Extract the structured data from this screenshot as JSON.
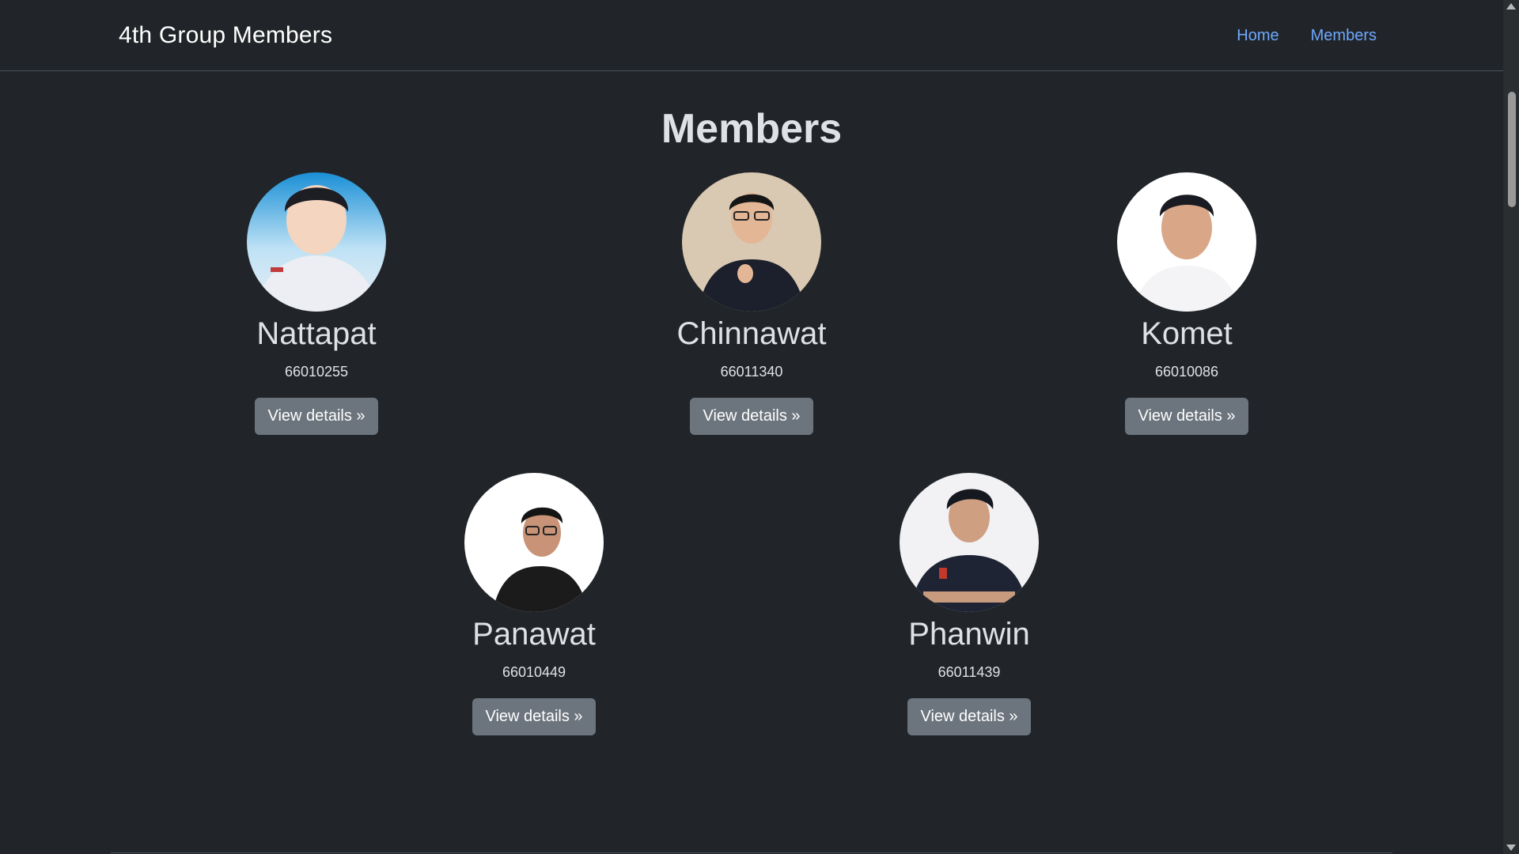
{
  "navbar": {
    "brand": "4th Group Members",
    "links": [
      {
        "label": "Home"
      },
      {
        "label": "Members"
      }
    ]
  },
  "main": {
    "title": "Members",
    "members": [
      {
        "name": "Nattapat",
        "id": "66010255",
        "button": "View details »"
      },
      {
        "name": "Chinnawat",
        "id": "66011340",
        "button": "View details »"
      },
      {
        "name": "Komet",
        "id": "66010086",
        "button": "View details »"
      },
      {
        "name": "Panawat",
        "id": "66010449",
        "button": "View details »"
      },
      {
        "name": "Phanwin",
        "id": "66011439",
        "button": "View details »"
      }
    ]
  },
  "colors": {
    "background": "#212529",
    "link": "#6ea8fe",
    "button": "#6c757d"
  }
}
